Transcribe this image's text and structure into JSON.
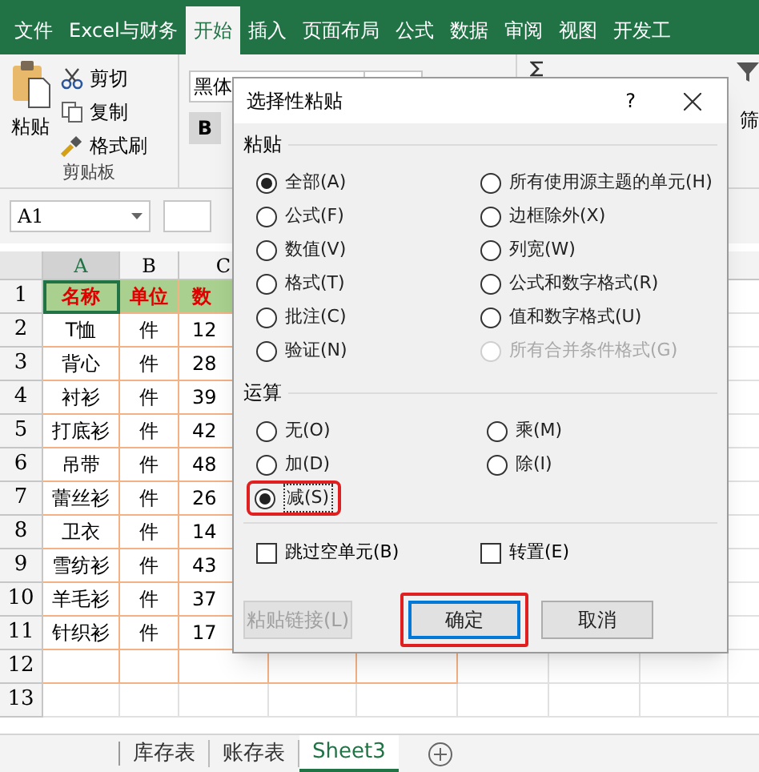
{
  "ribbon_tabs": [
    {
      "label": "文件",
      "selected": false
    },
    {
      "label": "Excel与财务",
      "selected": false
    },
    {
      "label": "开始",
      "selected": true
    },
    {
      "label": "插入",
      "selected": false
    },
    {
      "label": "页面布局",
      "selected": false
    },
    {
      "label": "公式",
      "selected": false
    },
    {
      "label": "数据",
      "selected": false
    },
    {
      "label": "审阅",
      "selected": false
    },
    {
      "label": "视图",
      "selected": false
    },
    {
      "label": "开发工",
      "selected": false
    }
  ],
  "clipboard": {
    "paste": "粘贴",
    "cut": "剪切",
    "copy": "复制",
    "format_painter": "格式刷",
    "group_label": "剪贴板"
  },
  "font": {
    "name": "黑体",
    "bold": "B"
  },
  "editing": {
    "filter": "筛"
  },
  "name_box": "A1",
  "sheet": {
    "columns": [
      {
        "label": "A",
        "selected": true
      },
      {
        "label": "B",
        "selected": false
      },
      {
        "label": "C",
        "selected": false
      }
    ],
    "rows": [
      {
        "number": "1",
        "cells": [
          "名称",
          "单位",
          "数"
        ]
      },
      {
        "number": "2",
        "cells": [
          "T恤",
          "件",
          "12"
        ]
      },
      {
        "number": "3",
        "cells": [
          "背心",
          "件",
          "28"
        ]
      },
      {
        "number": "4",
        "cells": [
          "衬衫",
          "件",
          "39"
        ]
      },
      {
        "number": "5",
        "cells": [
          "打底衫",
          "件",
          "42"
        ]
      },
      {
        "number": "6",
        "cells": [
          "吊带",
          "件",
          "48"
        ]
      },
      {
        "number": "7",
        "cells": [
          "蕾丝衫",
          "件",
          "26"
        ]
      },
      {
        "number": "8",
        "cells": [
          "卫衣",
          "件",
          "14"
        ]
      },
      {
        "number": "9",
        "cells": [
          "雪纺衫",
          "件",
          "43"
        ]
      },
      {
        "number": "10",
        "cells": [
          "羊毛衫",
          "件",
          "37"
        ]
      },
      {
        "number": "11",
        "cells": [
          "针织衫",
          "件",
          "17"
        ]
      },
      {
        "number": "12",
        "cells": []
      },
      {
        "number": "13",
        "cells": []
      }
    ]
  },
  "sheet_tabs": [
    {
      "label": "库存表",
      "selected": false
    },
    {
      "label": "账存表",
      "selected": false
    },
    {
      "label": "Sheet3",
      "selected": true
    }
  ],
  "dialog": {
    "title": "选择性粘贴",
    "help": "?",
    "paste_section": "粘贴",
    "paste_options": [
      {
        "label": "全部(A)",
        "selected": true,
        "disabled": false
      },
      {
        "label": "所有使用源主题的单元(H)",
        "selected": false,
        "disabled": false
      },
      {
        "label": "公式(F)",
        "selected": false,
        "disabled": false
      },
      {
        "label": "边框除外(X)",
        "selected": false,
        "disabled": false
      },
      {
        "label": "数值(V)",
        "selected": false,
        "disabled": false
      },
      {
        "label": "列宽(W)",
        "selected": false,
        "disabled": false
      },
      {
        "label": "格式(T)",
        "selected": false,
        "disabled": false
      },
      {
        "label": "公式和数字格式(R)",
        "selected": false,
        "disabled": false
      },
      {
        "label": "批注(C)",
        "selected": false,
        "disabled": false
      },
      {
        "label": "值和数字格式(U)",
        "selected": false,
        "disabled": false
      },
      {
        "label": "验证(N)",
        "selected": false,
        "disabled": false
      },
      {
        "label": "所有合并条件格式(G)",
        "selected": false,
        "disabled": true
      }
    ],
    "operation_section": "运算",
    "operation_options": [
      {
        "label": "无(O)",
        "selected": false,
        "highlighted": false
      },
      {
        "label": "乘(M)",
        "selected": false,
        "highlighted": false
      },
      {
        "label": "加(D)",
        "selected": false,
        "highlighted": false
      },
      {
        "label": "除(I)",
        "selected": false,
        "highlighted": false
      },
      {
        "label": "减(S)",
        "selected": true,
        "highlighted": true
      }
    ],
    "checkboxes": [
      {
        "label": "跳过空单元(B)",
        "checked": false
      },
      {
        "label": "转置(E)",
        "checked": false
      }
    ],
    "buttons": [
      {
        "label": "粘贴链接(L)",
        "disabled": true,
        "default": false,
        "highlighted": false
      },
      {
        "label": "确定",
        "disabled": false,
        "default": true,
        "highlighted": true
      },
      {
        "label": "取消",
        "disabled": false,
        "default": false,
        "highlighted": false
      }
    ]
  }
}
